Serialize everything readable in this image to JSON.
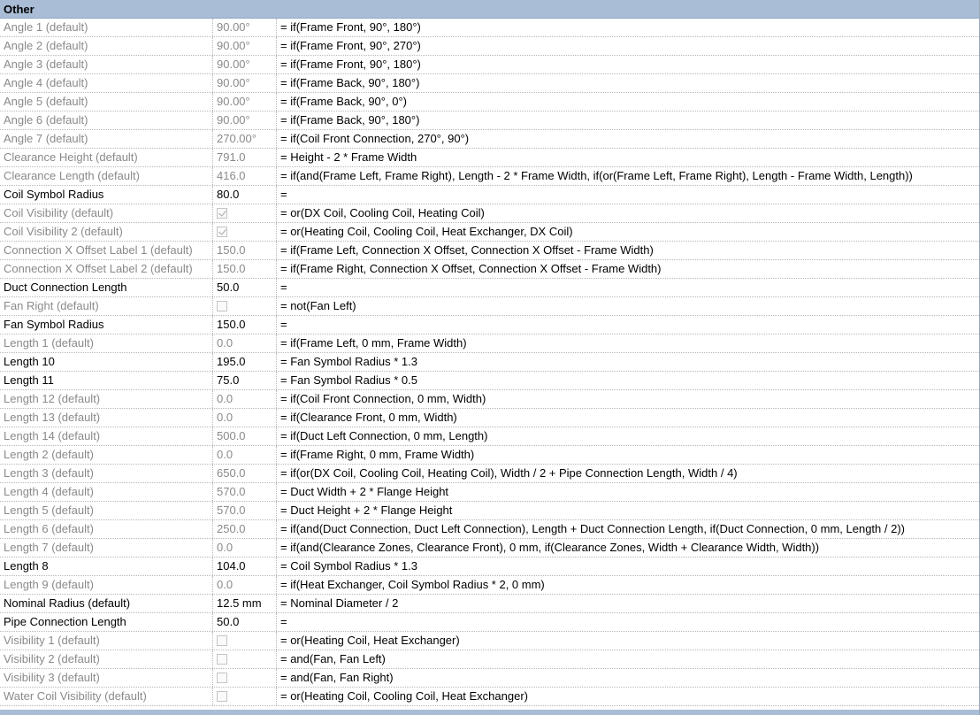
{
  "group": {
    "label": "Other"
  },
  "colors": {
    "header_bg": "#a9bdd6",
    "inherited_text": "#8a8a8a",
    "editable_text": "#000000"
  },
  "rows": [
    {
      "name": "Angle 1 (default)",
      "value": "90.00°",
      "formula": "= if(Frame Front, 90°, 180°)",
      "kind": "inherited"
    },
    {
      "name": "Angle 2 (default)",
      "value": "90.00°",
      "formula": "= if(Frame Front, 90°, 270°)",
      "kind": "inherited"
    },
    {
      "name": "Angle 3 (default)",
      "value": "90.00°",
      "formula": "= if(Frame Front, 90°, 180°)",
      "kind": "inherited"
    },
    {
      "name": "Angle 4 (default)",
      "value": "90.00°",
      "formula": "= if(Frame Back, 90°, 180°)",
      "kind": "inherited"
    },
    {
      "name": "Angle 5 (default)",
      "value": "90.00°",
      "formula": "= if(Frame Back, 90°, 0°)",
      "kind": "inherited"
    },
    {
      "name": "Angle 6 (default)",
      "value": "90.00°",
      "formula": "= if(Frame Back, 90°, 180°)",
      "kind": "inherited"
    },
    {
      "name": "Angle 7 (default)",
      "value": "270.00°",
      "formula": "= if(Coil Front Connection, 270°, 90°)",
      "kind": "inherited"
    },
    {
      "name": "Clearance Height (default)",
      "value": "791.0",
      "formula": "= Height - 2 * Frame Width",
      "kind": "inherited"
    },
    {
      "name": "Clearance Length (default)",
      "value": "416.0",
      "formula": "= if(and(Frame Left, Frame Right), Length - 2 * Frame Width, if(or(Frame Left, Frame Right), Length - Frame Width, Length))",
      "kind": "inherited"
    },
    {
      "name": "Coil Symbol Radius",
      "value": "80.0",
      "formula": "=",
      "kind": "editable"
    },
    {
      "name": "Coil Visibility (default)",
      "value": "",
      "checkbox": "checked",
      "formula": "= or(DX Coil, Cooling Coil, Heating Coil)",
      "kind": "inherited"
    },
    {
      "name": "Coil Visibility 2 (default)",
      "value": "",
      "checkbox": "checked",
      "formula": "= or(Heating Coil, Cooling Coil, Heat Exchanger, DX Coil)",
      "kind": "inherited"
    },
    {
      "name": "Connection X Offset Label 1 (default)",
      "value": "150.0",
      "formula": "= if(Frame Left, Connection X Offset, Connection X Offset - Frame Width)",
      "kind": "inherited"
    },
    {
      "name": "Connection X Offset Label 2 (default)",
      "value": "150.0",
      "formula": "= if(Frame Right, Connection X Offset, Connection X Offset - Frame Width)",
      "kind": "inherited"
    },
    {
      "name": "Duct Connection Length",
      "value": "50.0",
      "formula": "=",
      "kind": "editable"
    },
    {
      "name": "Fan Right (default)",
      "value": "",
      "checkbox": "unchecked",
      "formula": "= not(Fan Left)",
      "kind": "inherited"
    },
    {
      "name": "Fan Symbol Radius",
      "value": "150.0",
      "formula": "=",
      "kind": "editable"
    },
    {
      "name": "Length 1 (default)",
      "value": "0.0",
      "formula": "= if(Frame Left, 0 mm, Frame Width)",
      "kind": "inherited"
    },
    {
      "name": "Length 10",
      "value": "195.0",
      "formula": "= Fan Symbol Radius * 1.3",
      "kind": "editable"
    },
    {
      "name": "Length 11",
      "value": "75.0",
      "formula": "= Fan Symbol Radius * 0.5",
      "kind": "editable"
    },
    {
      "name": "Length 12 (default)",
      "value": "0.0",
      "formula": "= if(Coil Front Connection, 0 mm, Width)",
      "kind": "inherited"
    },
    {
      "name": "Length 13 (default)",
      "value": "0.0",
      "formula": "= if(Clearance Front, 0 mm, Width)",
      "kind": "inherited"
    },
    {
      "name": "Length 14 (default)",
      "value": "500.0",
      "formula": "= if(Duct Left Connection, 0 mm, Length)",
      "kind": "inherited"
    },
    {
      "name": "Length 2 (default)",
      "value": "0.0",
      "formula": "= if(Frame Right, 0 mm, Frame Width)",
      "kind": "inherited"
    },
    {
      "name": "Length 3 (default)",
      "value": "650.0",
      "formula": "= if(or(DX Coil, Cooling Coil, Heating Coil), Width / 2 + Pipe Connection Length, Width / 4)",
      "kind": "inherited"
    },
    {
      "name": "Length 4 (default)",
      "value": "570.0",
      "formula": "= Duct Width + 2 * Flange Height",
      "kind": "inherited"
    },
    {
      "name": "Length 5 (default)",
      "value": "570.0",
      "formula": "= Duct Height + 2 * Flange Height",
      "kind": "inherited"
    },
    {
      "name": "Length 6 (default)",
      "value": "250.0",
      "formula": "= if(and(Duct Connection, Duct Left Connection), Length + Duct Connection Length, if(Duct Connection, 0 mm, Length / 2))",
      "kind": "inherited"
    },
    {
      "name": "Length 7 (default)",
      "value": "0.0",
      "formula": "= if(and(Clearance Zones, Clearance Front), 0 mm, if(Clearance Zones, Width + Clearance Width, Width))",
      "kind": "inherited"
    },
    {
      "name": "Length 8",
      "value": "104.0",
      "formula": "= Coil Symbol Radius * 1.3",
      "kind": "editable"
    },
    {
      "name": "Length 9 (default)",
      "value": "0.0",
      "formula": "= if(Heat Exchanger, Coil Symbol Radius * 2, 0 mm)",
      "kind": "inherited"
    },
    {
      "name": "Nominal Radius (default)",
      "value": "12.5 mm",
      "formula": "= Nominal Diameter / 2",
      "kind": "editable"
    },
    {
      "name": "Pipe Connection Length",
      "value": "50.0",
      "formula": "=",
      "kind": "editable"
    },
    {
      "name": "Visibility 1 (default)",
      "value": "",
      "checkbox": "unchecked",
      "formula": "= or(Heating Coil, Heat Exchanger)",
      "kind": "inherited"
    },
    {
      "name": "Visibility 2 (default)",
      "value": "",
      "checkbox": "unchecked",
      "formula": "= and(Fan, Fan Left)",
      "kind": "inherited"
    },
    {
      "name": "Visibility 3 (default)",
      "value": "",
      "checkbox": "unchecked",
      "formula": "= and(Fan, Fan Right)",
      "kind": "inherited"
    },
    {
      "name": "Water Coil Visibility (default)",
      "value": "",
      "checkbox": "unchecked",
      "formula": "= or(Heating Coil, Cooling Coil, Heat Exchanger)",
      "kind": "inherited"
    }
  ]
}
